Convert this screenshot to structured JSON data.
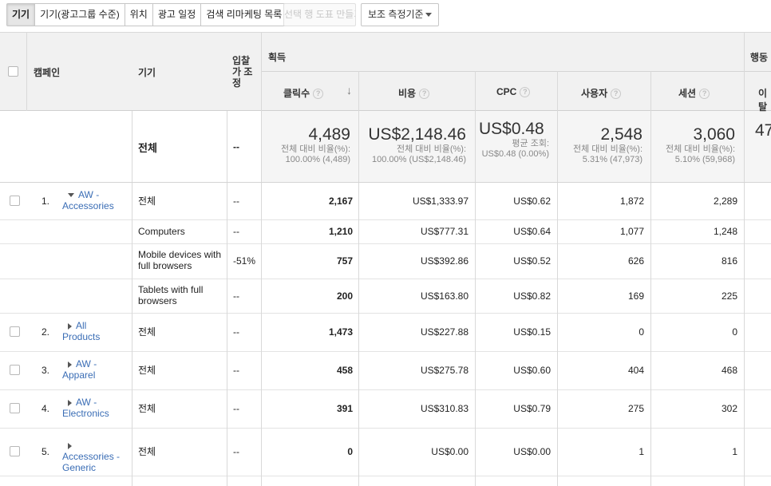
{
  "toolbar": {
    "tabs": [
      "기기",
      "기기(광고그룹 수준)",
      "위치",
      "광고 일정",
      "검색 리마케팅 목록"
    ],
    "create_pivot": "선택 행 도표 만들기",
    "secondary_dimension": "보조 측정기준"
  },
  "table": {
    "headers": {
      "campaign": "캠페인",
      "device": "기기",
      "bid_adjust": "입찰 가 조 정",
      "acquisition": "획득",
      "clicks": "클릭수",
      "cost": "비용",
      "cpc": "CPC",
      "users": "사용자",
      "sessions": "세션",
      "behavior": "행동",
      "bounce_partial": "이탈",
      "help_glyph": "?"
    },
    "totals": {
      "device": "전체",
      "bid": "--",
      "clicks": "4,489",
      "clicks_sub": "전체 대비 비율(%): 100.00% (4,489)",
      "cost": "US$2,148.46",
      "cost_sub": "전체 대비 비율(%): 100.00% (US$2,148.46)",
      "cpc": "US$0.48",
      "cpc_sub": "평균 조회: US$0.48 (0.00%)",
      "users": "2,548",
      "users_sub": "전체 대비 비율(%): 5.31% (47,973)",
      "sessions": "3,060",
      "sessions_sub": "전체 대비 비율(%): 5.10% (59,968)",
      "behavior_partial": "47"
    },
    "rows": [
      {
        "index": "1.",
        "campaign": "AW - Accessories",
        "expanded": true,
        "device": "전체",
        "bid": "--",
        "clicks": "2,167",
        "cost": "US$1,333.97",
        "cpc": "US$0.62",
        "users": "1,872",
        "sessions": "2,289"
      },
      {
        "index": "",
        "campaign": "",
        "device": "Computers",
        "bid": "--",
        "clicks": "1,210",
        "cost": "US$777.31",
        "cpc": "US$0.64",
        "users": "1,077",
        "sessions": "1,248"
      },
      {
        "index": "",
        "campaign": "",
        "device": "Mobile devices with full browsers",
        "bid": "-51%",
        "clicks": "757",
        "cost": "US$392.86",
        "cpc": "US$0.52",
        "users": "626",
        "sessions": "816"
      },
      {
        "index": "",
        "campaign": "",
        "device": "Tablets with full browsers",
        "bid": "--",
        "clicks": "200",
        "cost": "US$163.80",
        "cpc": "US$0.82",
        "users": "169",
        "sessions": "225"
      },
      {
        "index": "2.",
        "campaign": "All Products",
        "device": "전체",
        "bid": "--",
        "clicks": "1,473",
        "cost": "US$227.88",
        "cpc": "US$0.15",
        "users": "0",
        "sessions": "0"
      },
      {
        "index": "3.",
        "campaign": "AW - Apparel",
        "device": "전체",
        "bid": "--",
        "clicks": "458",
        "cost": "US$275.78",
        "cpc": "US$0.60",
        "users": "404",
        "sessions": "468"
      },
      {
        "index": "4.",
        "campaign": "AW - Electronics",
        "device": "전체",
        "bid": "--",
        "clicks": "391",
        "cost": "US$310.83",
        "cpc": "US$0.79",
        "users": "275",
        "sessions": "302"
      },
      {
        "index": "5.",
        "campaign": "Accessories - Generic",
        "device": "전체",
        "bid": "--",
        "clicks": "0",
        "cost": "US$0.00",
        "cpc": "US$0.00",
        "users": "1",
        "sessions": "1"
      }
    ]
  }
}
